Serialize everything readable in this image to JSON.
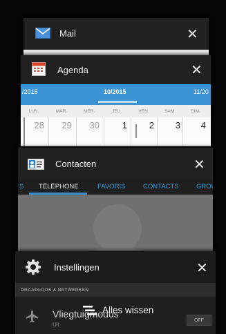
{
  "recent_apps": {
    "mail": {
      "title": "Mail",
      "close": "✕"
    },
    "agenda": {
      "title": "Agenda",
      "close": "✕",
      "months": {
        "prev": "/2015",
        "current": "10/2015",
        "next": "11/20"
      },
      "day_names": [
        "LUN.",
        "MAR.",
        "MER.",
        "JEU.",
        "VEN.",
        "SAM.",
        "DIM."
      ],
      "dates": [
        "28",
        "29",
        "30",
        "1",
        "2",
        "3",
        "4"
      ]
    },
    "contacten": {
      "title": "Contacten",
      "close": "✕",
      "tabs": [
        "S",
        "TÉLÉPHONE",
        "FAVORIS",
        "CONTACTS",
        "GROU"
      ]
    },
    "instellingen": {
      "title": "Instellingen",
      "close": "✕",
      "section": "DRAADLOOS & NETWERKEN",
      "flight_mode": {
        "label": "Vliegtuigmodus",
        "sub": "Uit",
        "toggle": "OFF"
      }
    }
  },
  "clear_all": {
    "label": "Alles wissen"
  },
  "colors": {
    "accent": "#3c93d3",
    "header": "#212121",
    "background": "#050505"
  }
}
